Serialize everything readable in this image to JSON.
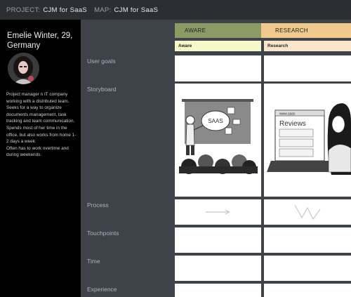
{
  "topbar": {
    "project_key": "PROJECT:",
    "project_value": "CJM for SaaS",
    "map_key": "MAP:",
    "map_value": "CJM for SaaS"
  },
  "persona": {
    "name": "Emelie Winter, 29, Germany",
    "description": [
      "Project manager n IT company working with a distributed team.",
      "Seeks for a way to organize documents management, task tracking and team communication.",
      "Spends most of her time in the office, but also works from home 1-2 days a week.",
      "Often has to work overtime and during weekends."
    ]
  },
  "rows": {
    "user_goals": "User goals",
    "storyboard": "Storyboard",
    "process": "Process",
    "touchpoints": "Touchpoints",
    "time": "Time",
    "experience": "Experience"
  },
  "stages": [
    {
      "label": "AWARE",
      "sublabel": "Aware",
      "color": "#8c9a66",
      "subcolor": "#f6f8c9"
    },
    {
      "label": "RESEARCH",
      "sublabel": "Research",
      "color": "#f0c98d",
      "subcolor": "#fbe6cc"
    }
  ],
  "storyboard": {
    "aware_board_text": "SAAS",
    "research_browser_url": "www.saas",
    "research_page_title": "Reviews"
  }
}
